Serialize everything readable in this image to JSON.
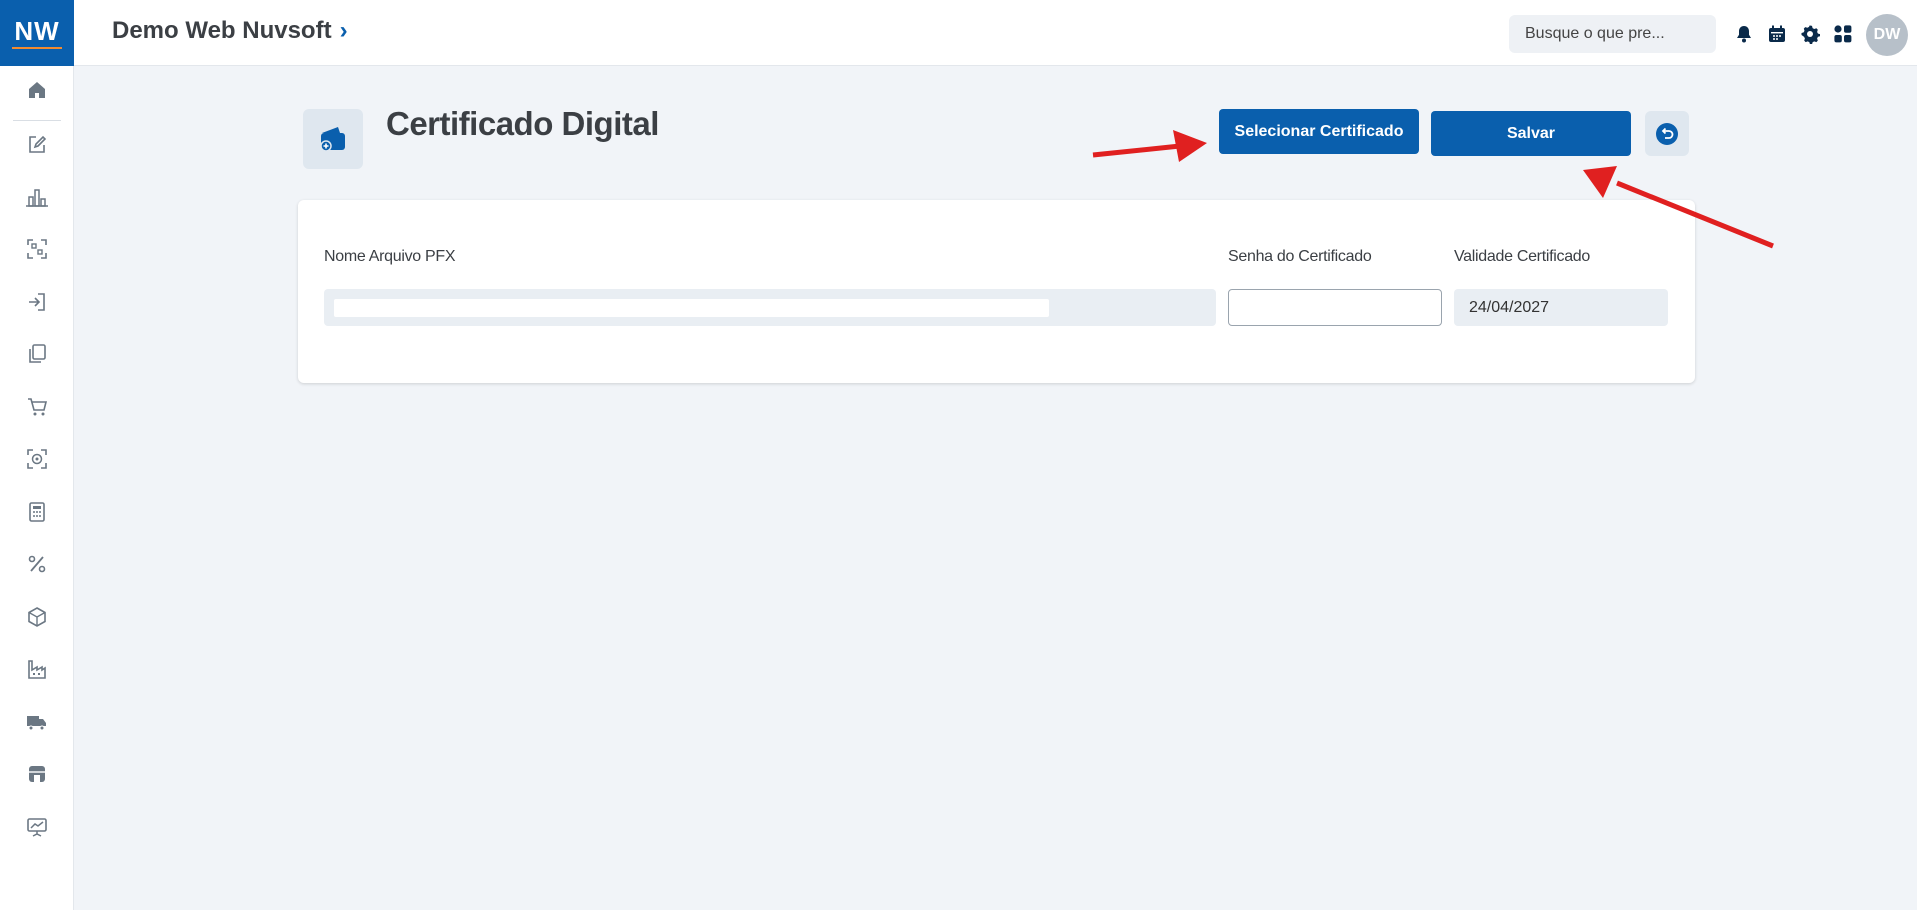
{
  "header": {
    "logo_text": "NW",
    "app_title": "Demo Web Nuvsoft",
    "app_title_chevron": "›",
    "search_placeholder": "Busque o que pre...",
    "icons": [
      "bell-icon",
      "calendar-icon",
      "gear-icon",
      "apps-grid-icon"
    ],
    "avatar_initials": "DW"
  },
  "sidebar": {
    "items": [
      {
        "icon": "home-icon"
      },
      {
        "icon": "edit-document-icon"
      },
      {
        "icon": "bar-chart-icon"
      },
      {
        "icon": "scan-icon"
      },
      {
        "icon": "login-icon"
      },
      {
        "icon": "copy-icon"
      },
      {
        "icon": "cart-icon"
      },
      {
        "icon": "target-icon"
      },
      {
        "icon": "calculator-icon"
      },
      {
        "icon": "percent-icon"
      },
      {
        "icon": "box-icon"
      },
      {
        "icon": "factory-icon"
      },
      {
        "icon": "truck-icon"
      },
      {
        "icon": "store-icon"
      },
      {
        "icon": "presentation-icon"
      }
    ]
  },
  "page": {
    "title": "Certificado Digital",
    "icon": "wallet-add-icon",
    "select_button_label": "Selecionar Certificado",
    "save_button_label": "Salvar",
    "back_icon": "undo-icon"
  },
  "form": {
    "pfx_label": "Nome Arquivo PFX",
    "pfx_value": "",
    "password_label": "Senha do Certificado",
    "password_value": "",
    "validity_label": "Validade Certificado",
    "validity_value": "24/04/2027"
  },
  "colors": {
    "primary": "#0a5fad",
    "logo_accent": "#f28b30",
    "background": "#f1f4f8",
    "annotation_arrow": "#e02020"
  }
}
